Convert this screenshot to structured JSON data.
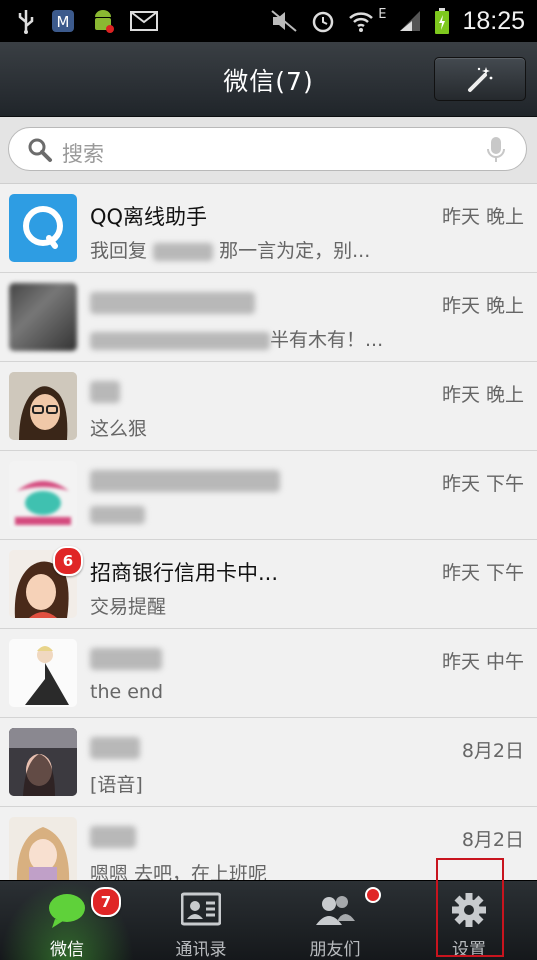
{
  "status_bar": {
    "time": "18:25",
    "network_type": "E",
    "icons": [
      "usb-icon",
      "shield-app-icon",
      "android-icon",
      "mail-icon",
      "mute-icon",
      "alarm-icon",
      "wifi-icon",
      "signal-icon",
      "battery-icon"
    ]
  },
  "header": {
    "title": "微信(7)",
    "action_icon": "magic-wand-icon"
  },
  "search": {
    "placeholder": "搜索",
    "icons": [
      "search-icon",
      "microphone-icon"
    ]
  },
  "chats": [
    {
      "name": "QQ离线助手",
      "time": "昨天 晚上",
      "preview_before": "我回复",
      "preview_after": "那一言为定，别...",
      "avatar": "qq-avatar",
      "badge": ""
    },
    {
      "name": "",
      "time": "昨天 晚上",
      "preview_before": "",
      "preview_after": "半有木有！...",
      "avatar": "blurred-avatar",
      "badge": ""
    },
    {
      "name": "",
      "time": "昨天 晚上",
      "preview_before": "这么狠",
      "preview_after": "",
      "avatar": "girl-glasses-avatar",
      "badge": ""
    },
    {
      "name": "",
      "time": "昨天 下午",
      "preview_before": "",
      "preview_after": "",
      "avatar": "pink-logo-avatar",
      "badge": ""
    },
    {
      "name": "招商银行信用卡中...",
      "time": "昨天 下午",
      "preview_before": "交易提醒",
      "preview_after": "",
      "avatar": "bank-avatar",
      "badge": "6"
    },
    {
      "name": "",
      "time": "昨天 中午",
      "preview_before": "the end",
      "preview_after": "",
      "avatar": "illustration-avatar",
      "badge": ""
    },
    {
      "name": "",
      "time": "8月2日",
      "preview_before": "[语音]",
      "preview_after": "",
      "avatar": "photo-avatar",
      "badge": ""
    },
    {
      "name": "",
      "time": "8月2日",
      "preview_before": "嗯嗯 去吧，在上班呢",
      "preview_after": "",
      "avatar": "anime-avatar",
      "badge": ""
    }
  ],
  "tabs": [
    {
      "label": "微信",
      "icon": "chat-bubble-icon",
      "badge": "7",
      "active": true
    },
    {
      "label": "通讯录",
      "icon": "contacts-icon",
      "badge": "",
      "active": false
    },
    {
      "label": "朋友们",
      "icon": "friends-icon",
      "badge": "dot",
      "active": false
    },
    {
      "label": "设置",
      "icon": "gear-icon",
      "badge": "",
      "active": false
    }
  ],
  "colors": {
    "badge": "#e02626",
    "highlight": "#c8141e",
    "active_tab_glow": "#50c83c"
  }
}
